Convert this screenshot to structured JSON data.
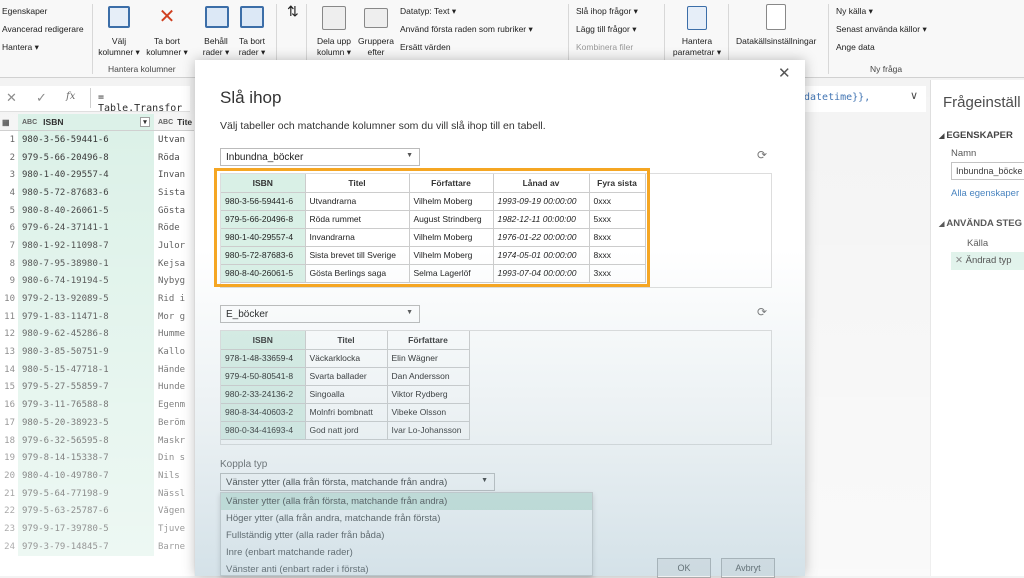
{
  "ribbon": {
    "left_items": [
      "Egenskaper",
      "Avancerad redigerare",
      "Hantera ▾"
    ],
    "valj_kolumner": "Välj kolumner ▾",
    "ta_bort_kolumner": "Ta bort kolumner ▾",
    "behall_rader": "Behåll rader ▾",
    "ta_bort_rader": "Ta bort rader ▾",
    "hantera_kolumner": "Hantera kolumner",
    "dela_upp": "Dela upp kolumn ▾",
    "gruppera": "Gruppera efter",
    "datatyp": "Datatyp: Text ▾",
    "anvand_forsta": "Använd första raden som rubriker ▾",
    "ersatt": "Ersätt värden",
    "sla_ihop_fragor": "Slå ihop frågor ▾",
    "lagg_till_fragor": "Lägg till frågor ▾",
    "kombinera_filer": "Kombinera filer",
    "hantera_parametrar": "Hantera parametrar ▾",
    "datakalls": "Datakällsinställningar",
    "ny_kalla": "Ny källa ▾",
    "senast": "Senast använda källor ▾",
    "ange_data": "Ange data",
    "ny_fraga": "Ny fråga"
  },
  "formula": {
    "text": "= Table.Transfor",
    "right_text": "datetime}},"
  },
  "grid": {
    "col1": "ISBN",
    "col2": "Tite",
    "rows": [
      {
        "n": "1",
        "isbn": "980-3-56-59441-6",
        "t": "Utvan"
      },
      {
        "n": "2",
        "isbn": "979-5-66-20496-8",
        "t": "Röda"
      },
      {
        "n": "3",
        "isbn": "980-1-40-29557-4",
        "t": "Invan"
      },
      {
        "n": "4",
        "isbn": "980-5-72-87683-6",
        "t": "Sista"
      },
      {
        "n": "5",
        "isbn": "980-8-40-26061-5",
        "t": "Gösta"
      },
      {
        "n": "6",
        "isbn": "979-6-24-37141-1",
        "t": "Röde"
      },
      {
        "n": "7",
        "isbn": "980-1-92-11098-7",
        "t": "Julor"
      },
      {
        "n": "8",
        "isbn": "980-7-95-38980-1",
        "t": "Kejsa"
      },
      {
        "n": "9",
        "isbn": "980-6-74-19194-5",
        "t": "Nybyg"
      },
      {
        "n": "10",
        "isbn": "979-2-13-92089-5",
        "t": "Rid i"
      },
      {
        "n": "11",
        "isbn": "979-1-83-11471-8",
        "t": "Mor g"
      },
      {
        "n": "12",
        "isbn": "980-9-62-45286-8",
        "t": "Humme"
      },
      {
        "n": "13",
        "isbn": "980-3-85-50751-9",
        "t": "Kallo"
      },
      {
        "n": "14",
        "isbn": "980-5-15-47718-1",
        "t": "Hände"
      },
      {
        "n": "15",
        "isbn": "979-5-27-55859-7",
        "t": "Hunde"
      },
      {
        "n": "16",
        "isbn": "979-3-11-76588-8",
        "t": "Egenm"
      },
      {
        "n": "17",
        "isbn": "980-5-20-38923-5",
        "t": "Beröm"
      },
      {
        "n": "18",
        "isbn": "979-6-32-56595-8",
        "t": "Maskr"
      },
      {
        "n": "19",
        "isbn": "979-8-14-15338-7",
        "t": "Din s"
      },
      {
        "n": "20",
        "isbn": "980-4-10-49780-7",
        "t": "Nils"
      },
      {
        "n": "21",
        "isbn": "979-5-64-77198-9",
        "t": "Nässl"
      },
      {
        "n": "22",
        "isbn": "979-5-63-25787-6",
        "t": "Vågen"
      },
      {
        "n": "23",
        "isbn": "979-9-17-39780-5",
        "t": "Tjuve"
      },
      {
        "n": "24",
        "isbn": "979-3-79-14845-7",
        "t": "Barne"
      }
    ]
  },
  "right_pane": {
    "title": "Frågeinställ",
    "egenskaper": "EGENSKAPER",
    "namn_label": "Namn",
    "namn_value": "Inbundna_böcke",
    "alla": "Alla egenskaper",
    "steg": "ANVÄNDA STEG",
    "steg1": "Källa",
    "steg2": "Ändrad typ"
  },
  "dialog": {
    "title": "Slå ihop",
    "subtitle": "Välj tabeller och matchande kolumner som du vill slå ihop till en tabell.",
    "table1_select": "Inbundna_böcker",
    "table1_headers": [
      "ISBN",
      "Titel",
      "Författare",
      "Lånad av",
      "Fyra sista"
    ],
    "table1_rows": [
      [
        "980-3-56-59441-6",
        "Utvandrarna",
        "Vilhelm Moberg",
        "1993-09-19 00:00:00",
        "0xxx"
      ],
      [
        "979-5-66-20496-8",
        "Röda rummet",
        "August Strindberg",
        "1982-12-11 00:00:00",
        "5xxx"
      ],
      [
        "980-1-40-29557-4",
        "Invandrarna",
        "Vilhelm Moberg",
        "1976-01-22 00:00:00",
        "8xxx"
      ],
      [
        "980-5-72-87683-6",
        "Sista brevet till Sverige",
        "Vilhelm Moberg",
        "1974-05-01 00:00:00",
        "8xxx"
      ],
      [
        "980-8-40-26061-5",
        "Gösta Berlings saga",
        "Selma Lagerlöf",
        "1993-07-04 00:00:00",
        "3xxx"
      ]
    ],
    "table2_select": "E_böcker",
    "table2_headers": [
      "ISBN",
      "Titel",
      "Författare"
    ],
    "table2_rows": [
      [
        "978-1-48-33659-4",
        "Väckarklocka",
        "Elin Wägner"
      ],
      [
        "979-4-50-80541-8",
        "Svarta ballader",
        "Dan Andersson"
      ],
      [
        "980-2-33-24136-2",
        "Singoalla",
        "Viktor Rydberg"
      ],
      [
        "980-8-34-40603-2",
        "Molnfri bombnatt",
        "Vibeke Olsson"
      ],
      [
        "980-0-34-41693-4",
        "God natt jord",
        "Ivar Lo-Johansson"
      ]
    ],
    "join_label": "Koppla typ",
    "join_value": "Vänster ytter (alla från första, matchande från andra)",
    "join_options": [
      "Vänster ytter (alla från första, matchande från andra)",
      "Höger ytter (alla från andra, matchande från första)",
      "Fullständig ytter (alla rader från båda)",
      "Inre (enbart matchande rader)",
      "Vänster anti (enbart rader i första)"
    ],
    "ok": "OK",
    "cancel": "Avbryt"
  },
  "colors": {
    "accent": "#f5a623",
    "key_column": "#d9f0e6"
  }
}
